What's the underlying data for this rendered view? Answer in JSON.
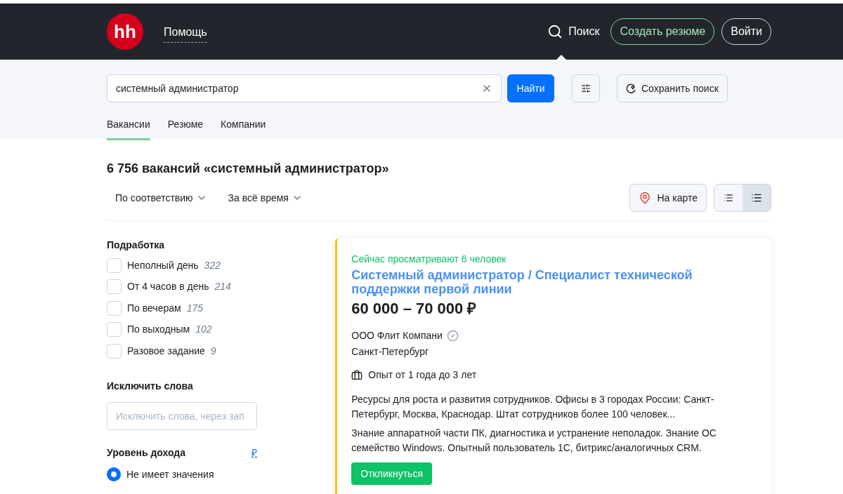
{
  "header": {
    "logo": "hh",
    "help_link": "Помощь",
    "nav": [
      {
        "label": "Поиск",
        "selected": true
      }
    ],
    "create_resume": "Создать резюме",
    "login": "Войти"
  },
  "search": {
    "value": "системный администратор",
    "submit": "Найти",
    "save_search": "Сохранить поиск"
  },
  "tabs": [
    {
      "label": "Вакансии",
      "selected": true
    },
    {
      "label": "Резюме",
      "selected": false
    },
    {
      "label": "Компании",
      "selected": false
    }
  ],
  "results_title": "6 756 вакансий «системный администратор»",
  "sort": [
    "По соответствию",
    "За всё время"
  ],
  "map_button": "На карте",
  "view_modes": [
    {
      "kind": "compact",
      "selected": false
    },
    {
      "kind": "detailed",
      "selected": true
    }
  ],
  "filters": {
    "part_time": {
      "title": "Подработка",
      "options": [
        {
          "label": "Неполный день",
          "count": "322",
          "checked": false
        },
        {
          "label": "От 4 часов в день",
          "count": "214",
          "checked": false
        },
        {
          "label": "По вечерам",
          "count": "175",
          "checked": false
        },
        {
          "label": "По выходным",
          "count": "102",
          "checked": false
        },
        {
          "label": "Разовое задание",
          "count": "9",
          "checked": false
        }
      ]
    },
    "exclude_words": {
      "title": "Исключить слова",
      "placeholder": "Исключить слова, через зап"
    },
    "income": {
      "title": "Уровень дохода",
      "currency": "₽",
      "options": [
        {
          "label": "Не имеет значения",
          "selected": true
        }
      ]
    }
  },
  "vacancy": {
    "viewers": "Сейчас просматривают 6 человек",
    "title": "Системный администратор / Специалист технической поддержки первой линии",
    "salary": "60 000 – 70 000 ₽",
    "company": "ООО Флит Компани",
    "verified": true,
    "city": "Санкт-Петербург",
    "experience": "Опыт от 1 года до 3 лет",
    "snippets": [
      "Ресурсы для роста и развития сотрудников. Офисы в 3 городах России: Санкт-Петербург, Москва, Краснодар. Штат сотрудников более 100 человек...",
      "Знание аппаратной части ПК, диагностика и устранение неполадок. Знание ОС семейство Windows. Опытный пользователь 1С, битрикс/аналогичных CRM."
    ],
    "respond": "Откликнуться"
  }
}
